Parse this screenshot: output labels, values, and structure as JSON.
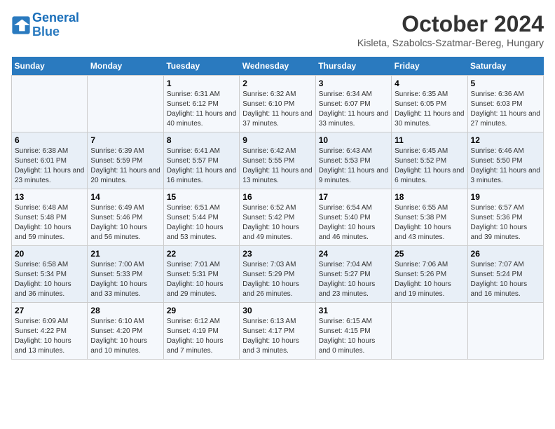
{
  "header": {
    "logo_line1": "General",
    "logo_line2": "Blue",
    "month": "October 2024",
    "location": "Kisleta, Szabolcs-Szatmar-Bereg, Hungary"
  },
  "days_of_week": [
    "Sunday",
    "Monday",
    "Tuesday",
    "Wednesday",
    "Thursday",
    "Friday",
    "Saturday"
  ],
  "weeks": [
    [
      {
        "day": "",
        "info": ""
      },
      {
        "day": "",
        "info": ""
      },
      {
        "day": "1",
        "info": "Sunrise: 6:31 AM\nSunset: 6:12 PM\nDaylight: 11 hours and 40 minutes."
      },
      {
        "day": "2",
        "info": "Sunrise: 6:32 AM\nSunset: 6:10 PM\nDaylight: 11 hours and 37 minutes."
      },
      {
        "day": "3",
        "info": "Sunrise: 6:34 AM\nSunset: 6:07 PM\nDaylight: 11 hours and 33 minutes."
      },
      {
        "day": "4",
        "info": "Sunrise: 6:35 AM\nSunset: 6:05 PM\nDaylight: 11 hours and 30 minutes."
      },
      {
        "day": "5",
        "info": "Sunrise: 6:36 AM\nSunset: 6:03 PM\nDaylight: 11 hours and 27 minutes."
      }
    ],
    [
      {
        "day": "6",
        "info": "Sunrise: 6:38 AM\nSunset: 6:01 PM\nDaylight: 11 hours and 23 minutes."
      },
      {
        "day": "7",
        "info": "Sunrise: 6:39 AM\nSunset: 5:59 PM\nDaylight: 11 hours and 20 minutes."
      },
      {
        "day": "8",
        "info": "Sunrise: 6:41 AM\nSunset: 5:57 PM\nDaylight: 11 hours and 16 minutes."
      },
      {
        "day": "9",
        "info": "Sunrise: 6:42 AM\nSunset: 5:55 PM\nDaylight: 11 hours and 13 minutes."
      },
      {
        "day": "10",
        "info": "Sunrise: 6:43 AM\nSunset: 5:53 PM\nDaylight: 11 hours and 9 minutes."
      },
      {
        "day": "11",
        "info": "Sunrise: 6:45 AM\nSunset: 5:52 PM\nDaylight: 11 hours and 6 minutes."
      },
      {
        "day": "12",
        "info": "Sunrise: 6:46 AM\nSunset: 5:50 PM\nDaylight: 11 hours and 3 minutes."
      }
    ],
    [
      {
        "day": "13",
        "info": "Sunrise: 6:48 AM\nSunset: 5:48 PM\nDaylight: 10 hours and 59 minutes."
      },
      {
        "day": "14",
        "info": "Sunrise: 6:49 AM\nSunset: 5:46 PM\nDaylight: 10 hours and 56 minutes."
      },
      {
        "day": "15",
        "info": "Sunrise: 6:51 AM\nSunset: 5:44 PM\nDaylight: 10 hours and 53 minutes."
      },
      {
        "day": "16",
        "info": "Sunrise: 6:52 AM\nSunset: 5:42 PM\nDaylight: 10 hours and 49 minutes."
      },
      {
        "day": "17",
        "info": "Sunrise: 6:54 AM\nSunset: 5:40 PM\nDaylight: 10 hours and 46 minutes."
      },
      {
        "day": "18",
        "info": "Sunrise: 6:55 AM\nSunset: 5:38 PM\nDaylight: 10 hours and 43 minutes."
      },
      {
        "day": "19",
        "info": "Sunrise: 6:57 AM\nSunset: 5:36 PM\nDaylight: 10 hours and 39 minutes."
      }
    ],
    [
      {
        "day": "20",
        "info": "Sunrise: 6:58 AM\nSunset: 5:34 PM\nDaylight: 10 hours and 36 minutes."
      },
      {
        "day": "21",
        "info": "Sunrise: 7:00 AM\nSunset: 5:33 PM\nDaylight: 10 hours and 33 minutes."
      },
      {
        "day": "22",
        "info": "Sunrise: 7:01 AM\nSunset: 5:31 PM\nDaylight: 10 hours and 29 minutes."
      },
      {
        "day": "23",
        "info": "Sunrise: 7:03 AM\nSunset: 5:29 PM\nDaylight: 10 hours and 26 minutes."
      },
      {
        "day": "24",
        "info": "Sunrise: 7:04 AM\nSunset: 5:27 PM\nDaylight: 10 hours and 23 minutes."
      },
      {
        "day": "25",
        "info": "Sunrise: 7:06 AM\nSunset: 5:26 PM\nDaylight: 10 hours and 19 minutes."
      },
      {
        "day": "26",
        "info": "Sunrise: 7:07 AM\nSunset: 5:24 PM\nDaylight: 10 hours and 16 minutes."
      }
    ],
    [
      {
        "day": "27",
        "info": "Sunrise: 6:09 AM\nSunset: 4:22 PM\nDaylight: 10 hours and 13 minutes."
      },
      {
        "day": "28",
        "info": "Sunrise: 6:10 AM\nSunset: 4:20 PM\nDaylight: 10 hours and 10 minutes."
      },
      {
        "day": "29",
        "info": "Sunrise: 6:12 AM\nSunset: 4:19 PM\nDaylight: 10 hours and 7 minutes."
      },
      {
        "day": "30",
        "info": "Sunrise: 6:13 AM\nSunset: 4:17 PM\nDaylight: 10 hours and 3 minutes."
      },
      {
        "day": "31",
        "info": "Sunrise: 6:15 AM\nSunset: 4:15 PM\nDaylight: 10 hours and 0 minutes."
      },
      {
        "day": "",
        "info": ""
      },
      {
        "day": "",
        "info": ""
      }
    ]
  ]
}
